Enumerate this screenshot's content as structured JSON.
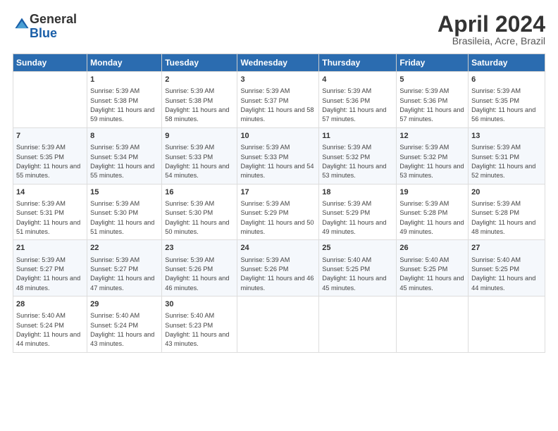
{
  "header": {
    "logo_general": "General",
    "logo_blue": "Blue",
    "month_title": "April 2024",
    "location": "Brasileia, Acre, Brazil"
  },
  "days_of_week": [
    "Sunday",
    "Monday",
    "Tuesday",
    "Wednesday",
    "Thursday",
    "Friday",
    "Saturday"
  ],
  "weeks": [
    [
      {
        "day": "",
        "sunrise": "",
        "sunset": "",
        "daylight": ""
      },
      {
        "day": "1",
        "sunrise": "Sunrise: 5:39 AM",
        "sunset": "Sunset: 5:38 PM",
        "daylight": "Daylight: 11 hours and 59 minutes."
      },
      {
        "day": "2",
        "sunrise": "Sunrise: 5:39 AM",
        "sunset": "Sunset: 5:38 PM",
        "daylight": "Daylight: 11 hours and 58 minutes."
      },
      {
        "day": "3",
        "sunrise": "Sunrise: 5:39 AM",
        "sunset": "Sunset: 5:37 PM",
        "daylight": "Daylight: 11 hours and 58 minutes."
      },
      {
        "day": "4",
        "sunrise": "Sunrise: 5:39 AM",
        "sunset": "Sunset: 5:36 PM",
        "daylight": "Daylight: 11 hours and 57 minutes."
      },
      {
        "day": "5",
        "sunrise": "Sunrise: 5:39 AM",
        "sunset": "Sunset: 5:36 PM",
        "daylight": "Daylight: 11 hours and 57 minutes."
      },
      {
        "day": "6",
        "sunrise": "Sunrise: 5:39 AM",
        "sunset": "Sunset: 5:35 PM",
        "daylight": "Daylight: 11 hours and 56 minutes."
      }
    ],
    [
      {
        "day": "7",
        "sunrise": "Sunrise: 5:39 AM",
        "sunset": "Sunset: 5:35 PM",
        "daylight": "Daylight: 11 hours and 55 minutes."
      },
      {
        "day": "8",
        "sunrise": "Sunrise: 5:39 AM",
        "sunset": "Sunset: 5:34 PM",
        "daylight": "Daylight: 11 hours and 55 minutes."
      },
      {
        "day": "9",
        "sunrise": "Sunrise: 5:39 AM",
        "sunset": "Sunset: 5:33 PM",
        "daylight": "Daylight: 11 hours and 54 minutes."
      },
      {
        "day": "10",
        "sunrise": "Sunrise: 5:39 AM",
        "sunset": "Sunset: 5:33 PM",
        "daylight": "Daylight: 11 hours and 54 minutes."
      },
      {
        "day": "11",
        "sunrise": "Sunrise: 5:39 AM",
        "sunset": "Sunset: 5:32 PM",
        "daylight": "Daylight: 11 hours and 53 minutes."
      },
      {
        "day": "12",
        "sunrise": "Sunrise: 5:39 AM",
        "sunset": "Sunset: 5:32 PM",
        "daylight": "Daylight: 11 hours and 53 minutes."
      },
      {
        "day": "13",
        "sunrise": "Sunrise: 5:39 AM",
        "sunset": "Sunset: 5:31 PM",
        "daylight": "Daylight: 11 hours and 52 minutes."
      }
    ],
    [
      {
        "day": "14",
        "sunrise": "Sunrise: 5:39 AM",
        "sunset": "Sunset: 5:31 PM",
        "daylight": "Daylight: 11 hours and 51 minutes."
      },
      {
        "day": "15",
        "sunrise": "Sunrise: 5:39 AM",
        "sunset": "Sunset: 5:30 PM",
        "daylight": "Daylight: 11 hours and 51 minutes."
      },
      {
        "day": "16",
        "sunrise": "Sunrise: 5:39 AM",
        "sunset": "Sunset: 5:30 PM",
        "daylight": "Daylight: 11 hours and 50 minutes."
      },
      {
        "day": "17",
        "sunrise": "Sunrise: 5:39 AM",
        "sunset": "Sunset: 5:29 PM",
        "daylight": "Daylight: 11 hours and 50 minutes."
      },
      {
        "day": "18",
        "sunrise": "Sunrise: 5:39 AM",
        "sunset": "Sunset: 5:29 PM",
        "daylight": "Daylight: 11 hours and 49 minutes."
      },
      {
        "day": "19",
        "sunrise": "Sunrise: 5:39 AM",
        "sunset": "Sunset: 5:28 PM",
        "daylight": "Daylight: 11 hours and 49 minutes."
      },
      {
        "day": "20",
        "sunrise": "Sunrise: 5:39 AM",
        "sunset": "Sunset: 5:28 PM",
        "daylight": "Daylight: 11 hours and 48 minutes."
      }
    ],
    [
      {
        "day": "21",
        "sunrise": "Sunrise: 5:39 AM",
        "sunset": "Sunset: 5:27 PM",
        "daylight": "Daylight: 11 hours and 48 minutes."
      },
      {
        "day": "22",
        "sunrise": "Sunrise: 5:39 AM",
        "sunset": "Sunset: 5:27 PM",
        "daylight": "Daylight: 11 hours and 47 minutes."
      },
      {
        "day": "23",
        "sunrise": "Sunrise: 5:39 AM",
        "sunset": "Sunset: 5:26 PM",
        "daylight": "Daylight: 11 hours and 46 minutes."
      },
      {
        "day": "24",
        "sunrise": "Sunrise: 5:39 AM",
        "sunset": "Sunset: 5:26 PM",
        "daylight": "Daylight: 11 hours and 46 minutes."
      },
      {
        "day": "25",
        "sunrise": "Sunrise: 5:40 AM",
        "sunset": "Sunset: 5:25 PM",
        "daylight": "Daylight: 11 hours and 45 minutes."
      },
      {
        "day": "26",
        "sunrise": "Sunrise: 5:40 AM",
        "sunset": "Sunset: 5:25 PM",
        "daylight": "Daylight: 11 hours and 45 minutes."
      },
      {
        "day": "27",
        "sunrise": "Sunrise: 5:40 AM",
        "sunset": "Sunset: 5:25 PM",
        "daylight": "Daylight: 11 hours and 44 minutes."
      }
    ],
    [
      {
        "day": "28",
        "sunrise": "Sunrise: 5:40 AM",
        "sunset": "Sunset: 5:24 PM",
        "daylight": "Daylight: 11 hours and 44 minutes."
      },
      {
        "day": "29",
        "sunrise": "Sunrise: 5:40 AM",
        "sunset": "Sunset: 5:24 PM",
        "daylight": "Daylight: 11 hours and 43 minutes."
      },
      {
        "day": "30",
        "sunrise": "Sunrise: 5:40 AM",
        "sunset": "Sunset: 5:23 PM",
        "daylight": "Daylight: 11 hours and 43 minutes."
      },
      {
        "day": "",
        "sunrise": "",
        "sunset": "",
        "daylight": ""
      },
      {
        "day": "",
        "sunrise": "",
        "sunset": "",
        "daylight": ""
      },
      {
        "day": "",
        "sunrise": "",
        "sunset": "",
        "daylight": ""
      },
      {
        "day": "",
        "sunrise": "",
        "sunset": "",
        "daylight": ""
      }
    ]
  ]
}
